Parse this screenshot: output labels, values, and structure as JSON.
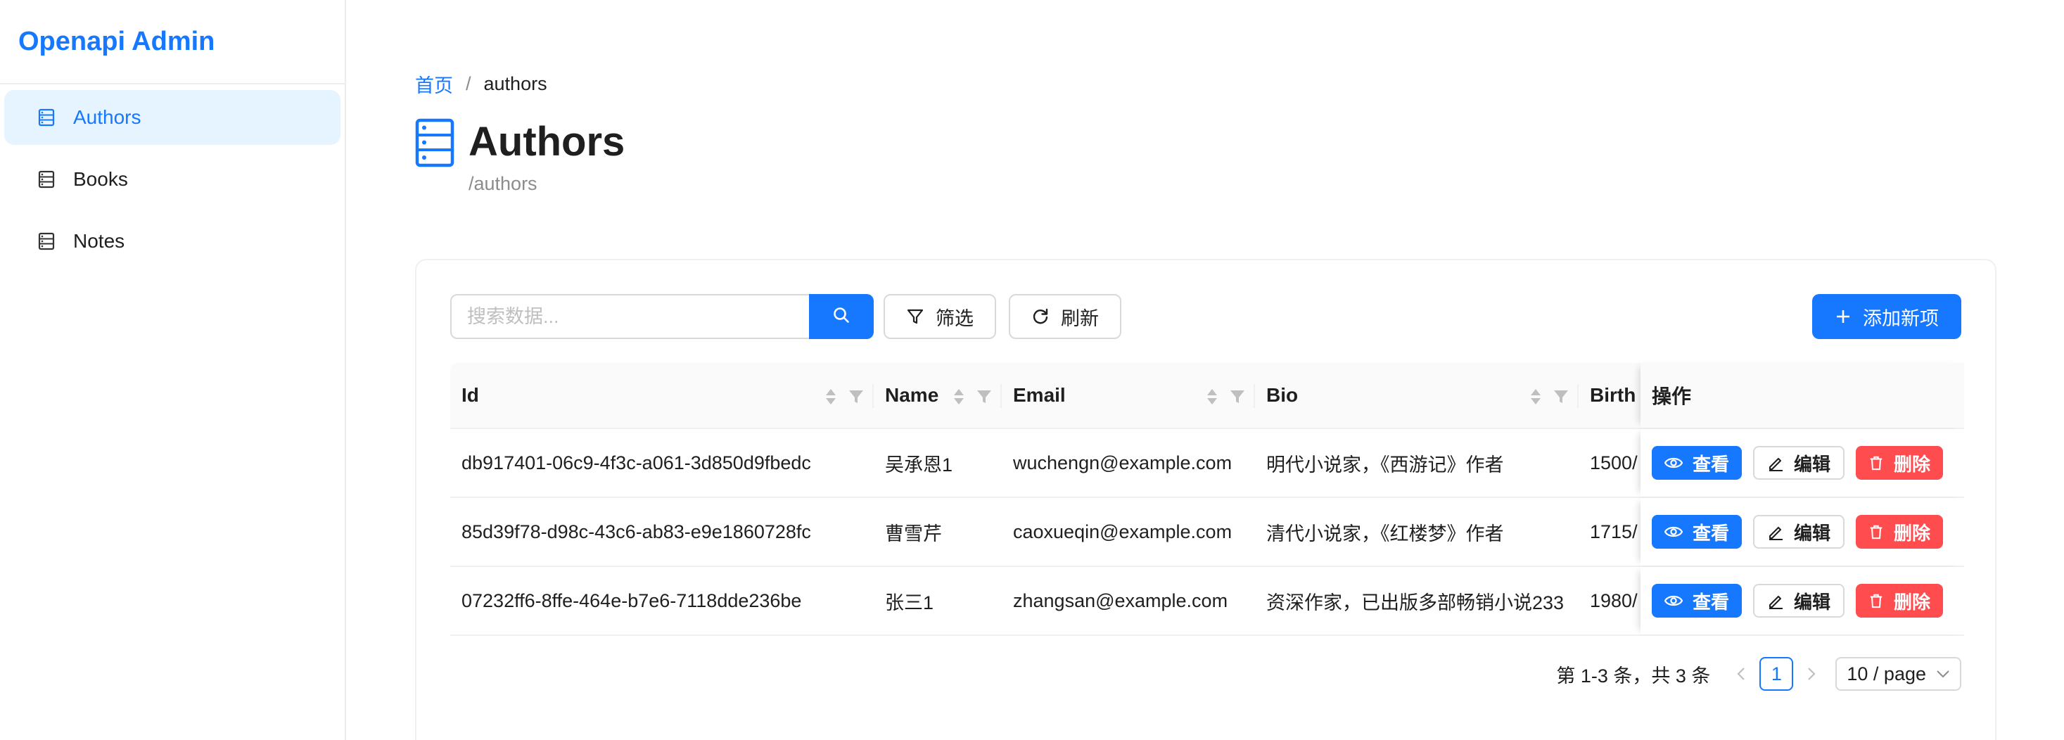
{
  "app": {
    "title": "Openapi Admin"
  },
  "sidebar": {
    "items": [
      {
        "label": "Authors",
        "icon": "database-icon",
        "active": true
      },
      {
        "label": "Books",
        "icon": "database-icon",
        "active": false
      },
      {
        "label": "Notes",
        "icon": "database-icon",
        "active": false
      }
    ]
  },
  "breadcrumb": {
    "home": "首页",
    "separator": "/",
    "current": "authors"
  },
  "page": {
    "title": "Authors",
    "subtitle": "/authors"
  },
  "toolbar": {
    "search_placeholder": "搜索数据...",
    "filter_label": "筛选",
    "refresh_label": "刷新",
    "add_label": "添加新项"
  },
  "table": {
    "columns": [
      "Id",
      "Name",
      "Email",
      "Bio",
      "Birth",
      "操作"
    ],
    "rows": [
      {
        "id": "db917401-06c9-4f3c-a061-3d850d9fbedc",
        "name": "吴承恩1",
        "email": "wuchengn@example.com",
        "bio": "明代小说家，《西游记》作者",
        "birth": "1500/"
      },
      {
        "id": "85d39f78-d98c-43c6-ab83-e9e1860728fc",
        "name": "曹雪芹",
        "email": "caoxueqin@example.com",
        "bio": "清代小说家，《红楼梦》作者",
        "birth": "1715/"
      },
      {
        "id": "07232ff6-8ffe-464e-b7e6-7118dde236be",
        "name": "张三1",
        "email": "zhangsan@example.com",
        "bio": "资深作家，已出版多部畅销小说233",
        "birth": "1980/"
      }
    ],
    "actions": {
      "view": "查看",
      "edit": "编辑",
      "delete": "删除"
    }
  },
  "pagination": {
    "total_text": "第 1-3 条，共 3 条",
    "current_page": "1",
    "page_size": "10 / page"
  },
  "colors": {
    "primary": "#1677ff",
    "danger": "#ff4d4f",
    "active_bg": "#e6f4ff"
  }
}
